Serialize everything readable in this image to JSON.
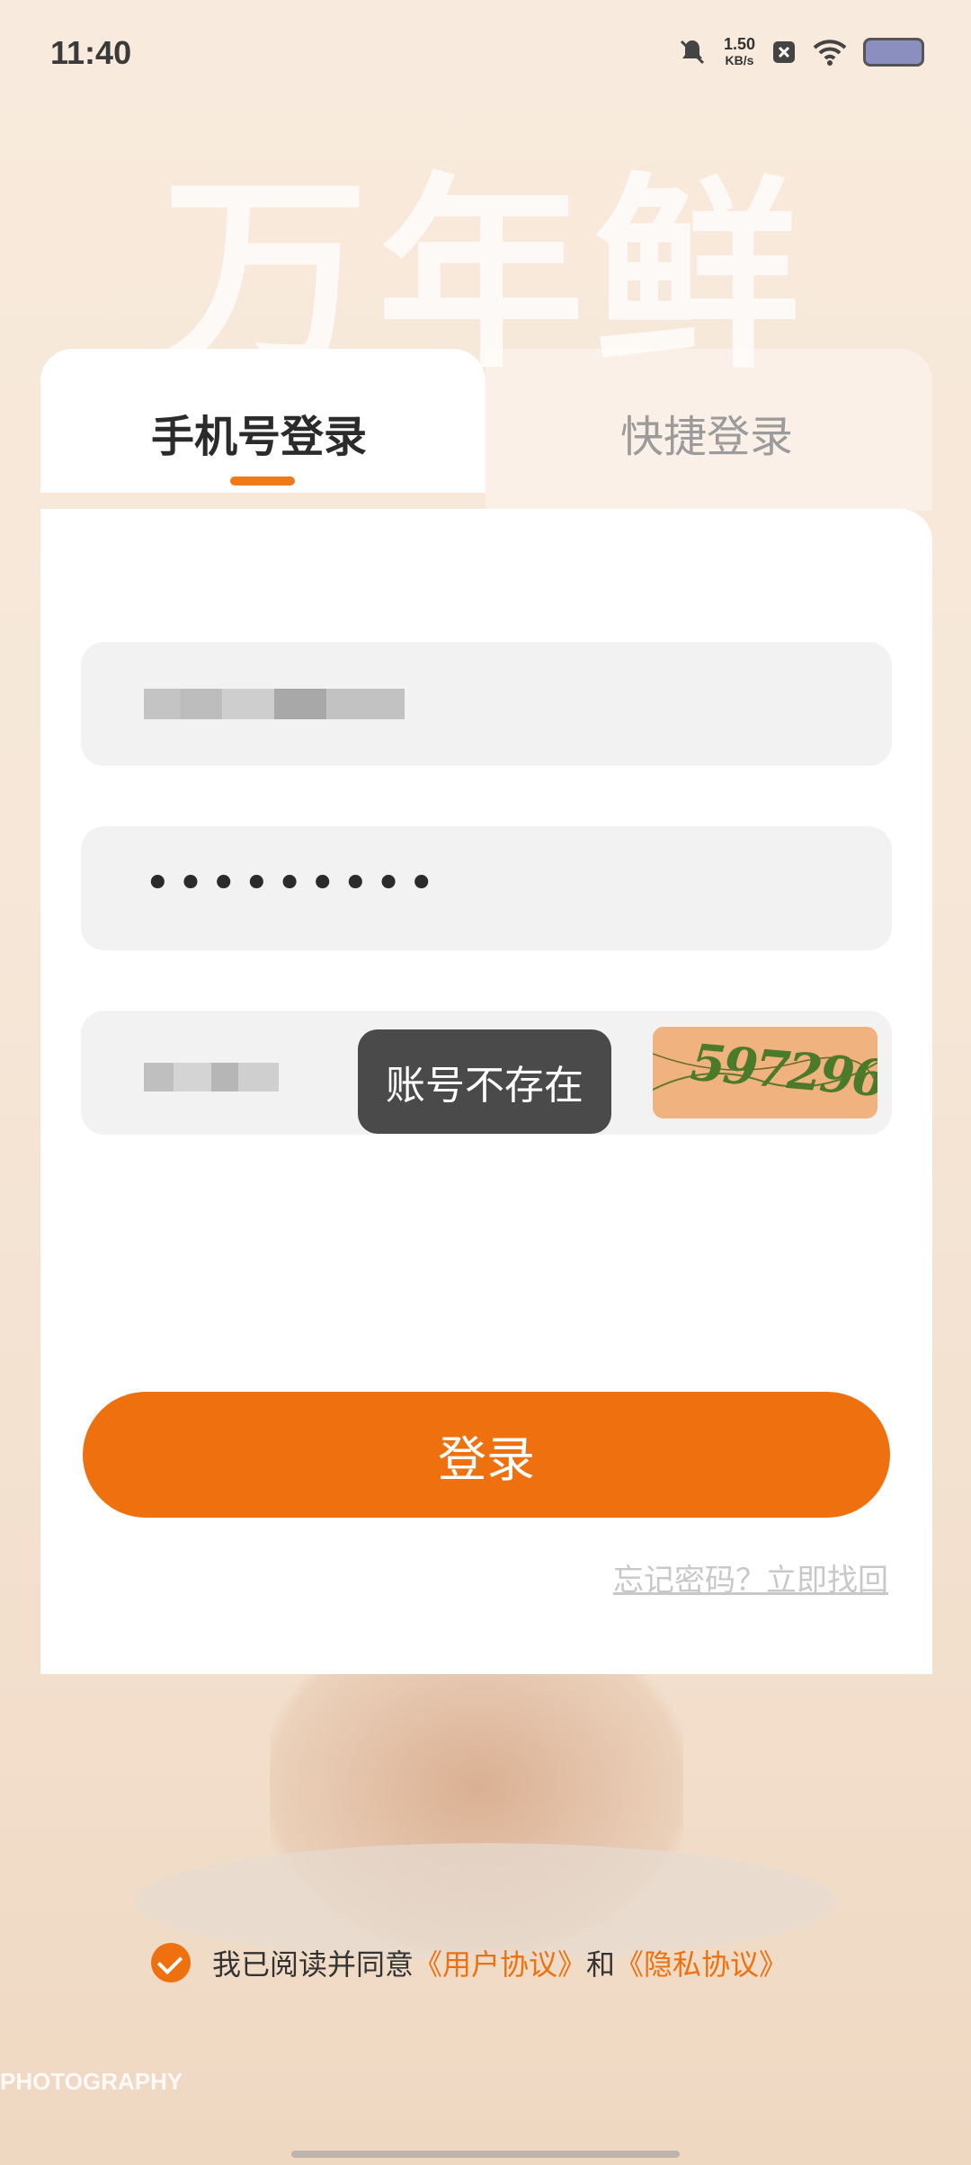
{
  "status_bar": {
    "time": "11:40",
    "speed_value": "1.50",
    "speed_unit": "KB/s"
  },
  "brand": {
    "title": "万年鲜"
  },
  "tabs": {
    "phone_login": "手机号登录",
    "quick_login": "快捷登录"
  },
  "form": {
    "password_mask": "•••••••••",
    "captcha_text": "597296"
  },
  "toast": {
    "message": "账号不存在"
  },
  "login_button": {
    "label": "登录"
  },
  "forgot": {
    "label": "忘记密码？立即找回"
  },
  "agreement": {
    "prefix": "我已阅读并同意",
    "user_agreement": "《用户协议》",
    "and": "和",
    "privacy_agreement": "《隐私协议》"
  },
  "background": {
    "watermark": "PHOTOGRAPHY"
  },
  "colors": {
    "accent": "#ee700f",
    "captcha_bg": "#f0b27e"
  }
}
